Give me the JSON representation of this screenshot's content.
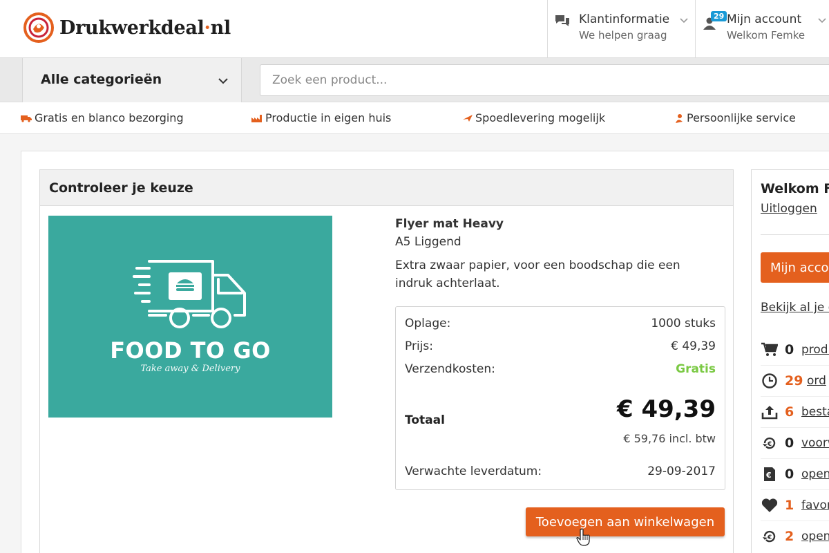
{
  "header": {
    "logo_text_before": "Drukwerkdeal",
    "logo_dot": "·",
    "logo_text_after": "nl",
    "info_title": "Klantinformatie",
    "info_sub": "We helpen graag",
    "account_badge": "29",
    "account_title": "Mijn account",
    "account_sub": "Welkom Femke"
  },
  "catbar": {
    "category_label": "Alle categorieën",
    "search_placeholder": "Zoek een product..."
  },
  "usps": [
    {
      "label": "Gratis en blanco bezorging",
      "icon": "truck-icon"
    },
    {
      "label": "Productie in eigen huis",
      "icon": "factory-icon"
    },
    {
      "label": "Spoedlevering mogelijk",
      "icon": "plane-icon"
    },
    {
      "label": "Persoonlijke service",
      "icon": "person-icon"
    }
  ],
  "check": {
    "title": "Controleer je keuze",
    "image_title": "FOOD TO GO",
    "image_subtitle": "Take away & Delivery",
    "product_name": "Flyer mat Heavy",
    "product_format": "A5 Liggend",
    "product_description": "Extra zwaar papier, voor een boodschap die een indruk achterlaat.",
    "oplage_label": "Oplage:",
    "oplage_value": "1000 stuks",
    "prijs_label": "Prijs:",
    "prijs_value": "€ 49,39",
    "verzend_label": "Verzendkosten:",
    "verzend_value": "Gratis",
    "totaal_label": "Totaal",
    "totaal_value": "€ 49,39",
    "totaal_btw": "€ 59,76 incl. btw",
    "leverdatum_label": "Verwachte leverdatum:",
    "leverdatum_value": "29-09-2017",
    "cart_button": "Toevoegen aan winkelwagen"
  },
  "sidebar": {
    "welcome": "Welkom F",
    "logout": "Uitloggen",
    "account_button": "Mijn acco",
    "view_all": "Bekijk al je o",
    "stats": [
      {
        "icon": "cart-icon",
        "count": "0",
        "label": "produ",
        "color": "dark"
      },
      {
        "icon": "clock-icon",
        "count": "29",
        "label": "ord",
        "color": "orange"
      },
      {
        "icon": "upload-icon",
        "count": "6",
        "label": "besta",
        "color": "orange"
      },
      {
        "icon": "euro-refresh-icon",
        "count": "0",
        "label": "voorw",
        "color": "dark"
      },
      {
        "icon": "euro-doc-icon",
        "count": "0",
        "label": "open",
        "color": "dark"
      },
      {
        "icon": "heart-icon",
        "count": "1",
        "label": "favor",
        "color": "orange"
      },
      {
        "icon": "euro-refresh-icon",
        "count": "2",
        "label": "open",
        "color": "orange"
      }
    ]
  },
  "colors": {
    "accent": "#e4601e",
    "green": "#7ac943",
    "teal": "#3aa99e",
    "badge": "#1a9ad6"
  }
}
